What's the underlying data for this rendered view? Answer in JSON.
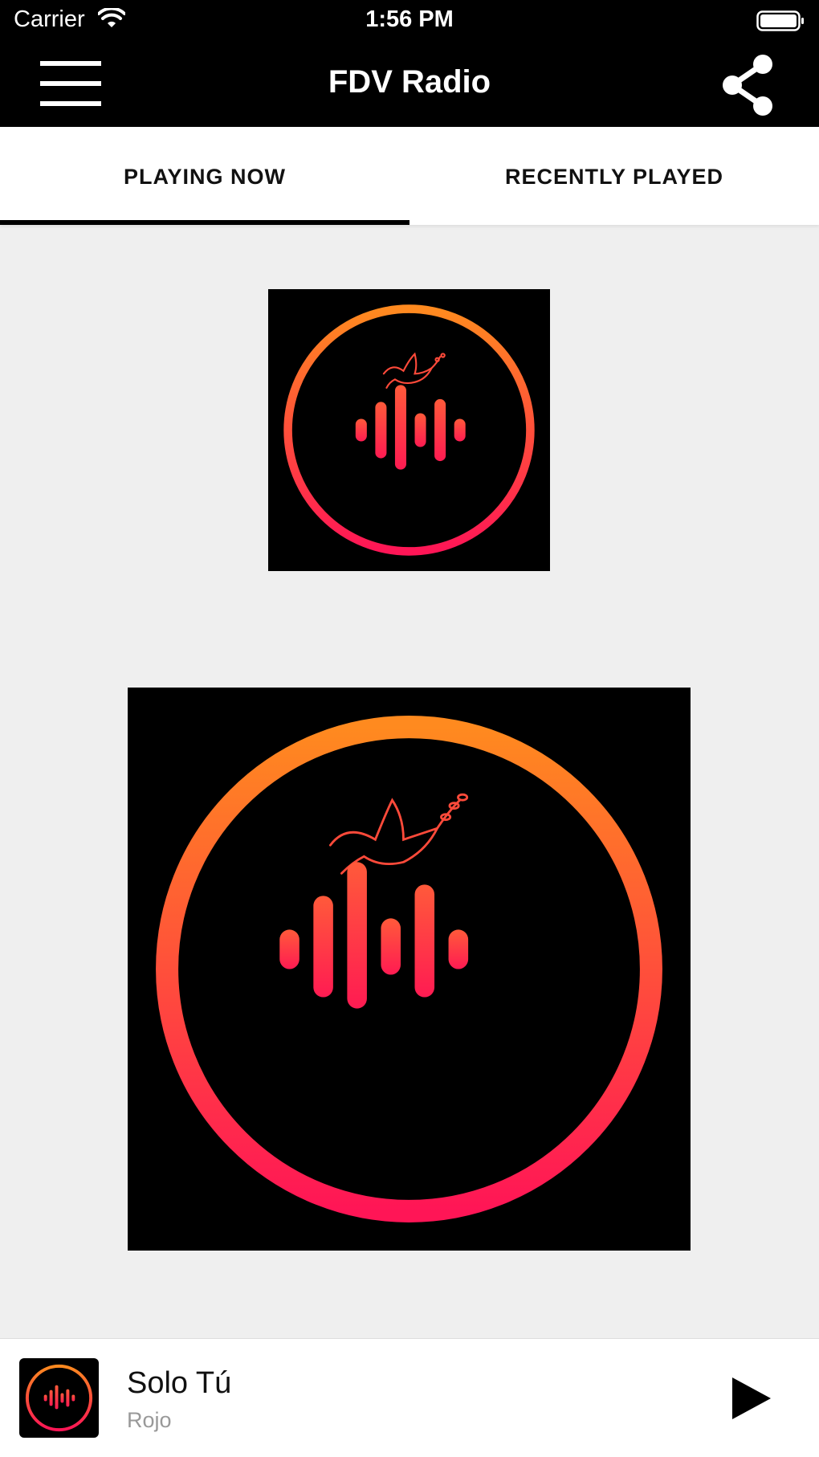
{
  "status_bar": {
    "carrier": "Carrier",
    "time": "1:56 PM"
  },
  "nav": {
    "title": "FDV Radio",
    "menu_icon": "hamburger-menu-icon",
    "share_icon": "share-icon"
  },
  "tabs": [
    {
      "label": "PLAYING NOW",
      "active": true
    },
    {
      "label": "RECENTLY PLAYED",
      "active": false
    }
  ],
  "player": {
    "title": "Solo Tú",
    "artist": "Rojo",
    "play_icon": "play-icon"
  },
  "colors": {
    "accent_top": "#ff8a1f",
    "accent_bottom": "#ff1556",
    "bar": "#000000"
  }
}
